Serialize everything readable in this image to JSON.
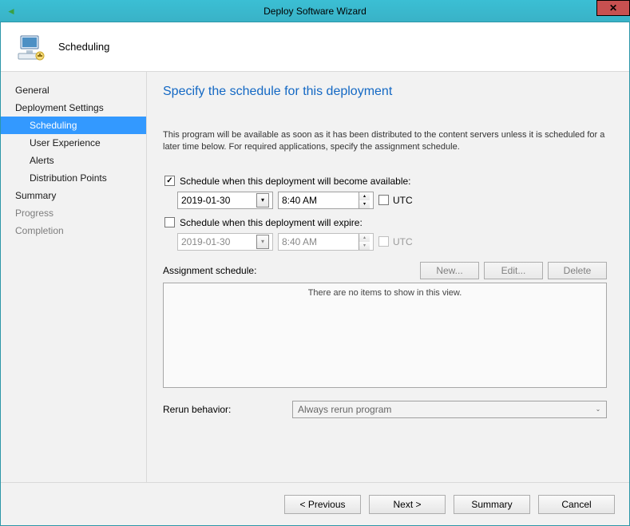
{
  "window": {
    "title": "Deploy Software Wizard",
    "step_heading": "Scheduling"
  },
  "nav": {
    "general": "General",
    "deployment_settings": "Deployment Settings",
    "scheduling": "Scheduling",
    "user_experience": "User Experience",
    "alerts": "Alerts",
    "distribution_points": "Distribution Points",
    "summary": "Summary",
    "progress": "Progress",
    "completion": "Completion"
  },
  "panel": {
    "title": "Specify the schedule for this deployment",
    "intro": "This program will be available as soon as it has been distributed to the content servers unless it is scheduled for a later time below. For required applications, specify the assignment schedule.",
    "schedule_available_label": "Schedule when this deployment will become available:",
    "schedule_expire_label": "Schedule when this deployment will expire:",
    "date_available": "2019-01-30",
    "time_available": "8:40 AM",
    "date_expire": "2019-01-30",
    "time_expire": "8:40 AM",
    "utc_label": "UTC",
    "assignment_label": "Assignment schedule:",
    "btn_new": "New...",
    "btn_edit": "Edit...",
    "btn_delete": "Delete",
    "empty_list": "There are no items to show in this view.",
    "rerun_label": "Rerun behavior:",
    "rerun_value": "Always rerun program"
  },
  "footer": {
    "previous": "< Previous",
    "next": "Next >",
    "summary": "Summary",
    "cancel": "Cancel"
  }
}
